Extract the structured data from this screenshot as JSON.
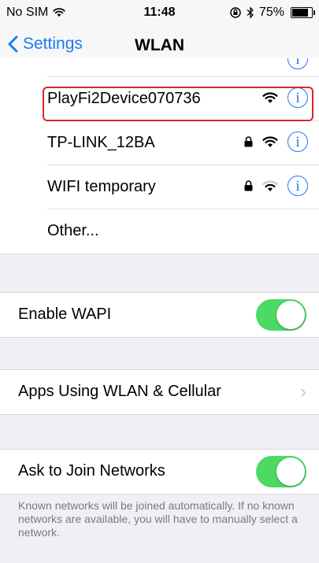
{
  "status_bar": {
    "carrier": "No SIM",
    "time": "11:48",
    "battery": "75%",
    "battery_level": 0.75
  },
  "nav": {
    "back_label": "Settings",
    "title": "WLAN"
  },
  "networks": [
    {
      "name": "PlayFi2Device070736",
      "locked": false,
      "signal": "full",
      "highlighted": true
    },
    {
      "name": "TP-LINK_12BA",
      "locked": true,
      "signal": "full"
    },
    {
      "name": "WIFI temporary",
      "locked": true,
      "signal": "medium"
    }
  ],
  "other_label": "Other...",
  "info_glyph": "i",
  "settings": {
    "enable_wapi": {
      "label": "Enable WAPI",
      "on": true
    },
    "apps_using": {
      "label": "Apps Using WLAN & Cellular"
    },
    "ask_to_join": {
      "label": "Ask to Join Networks",
      "on": true
    }
  },
  "footer": "Known networks will be joined automatically. If no known networks are available, you will have to manually select a network.",
  "colors": {
    "accent": "#1a7cf5",
    "toggle_on": "#4cd964",
    "highlight": "#d9262c"
  }
}
